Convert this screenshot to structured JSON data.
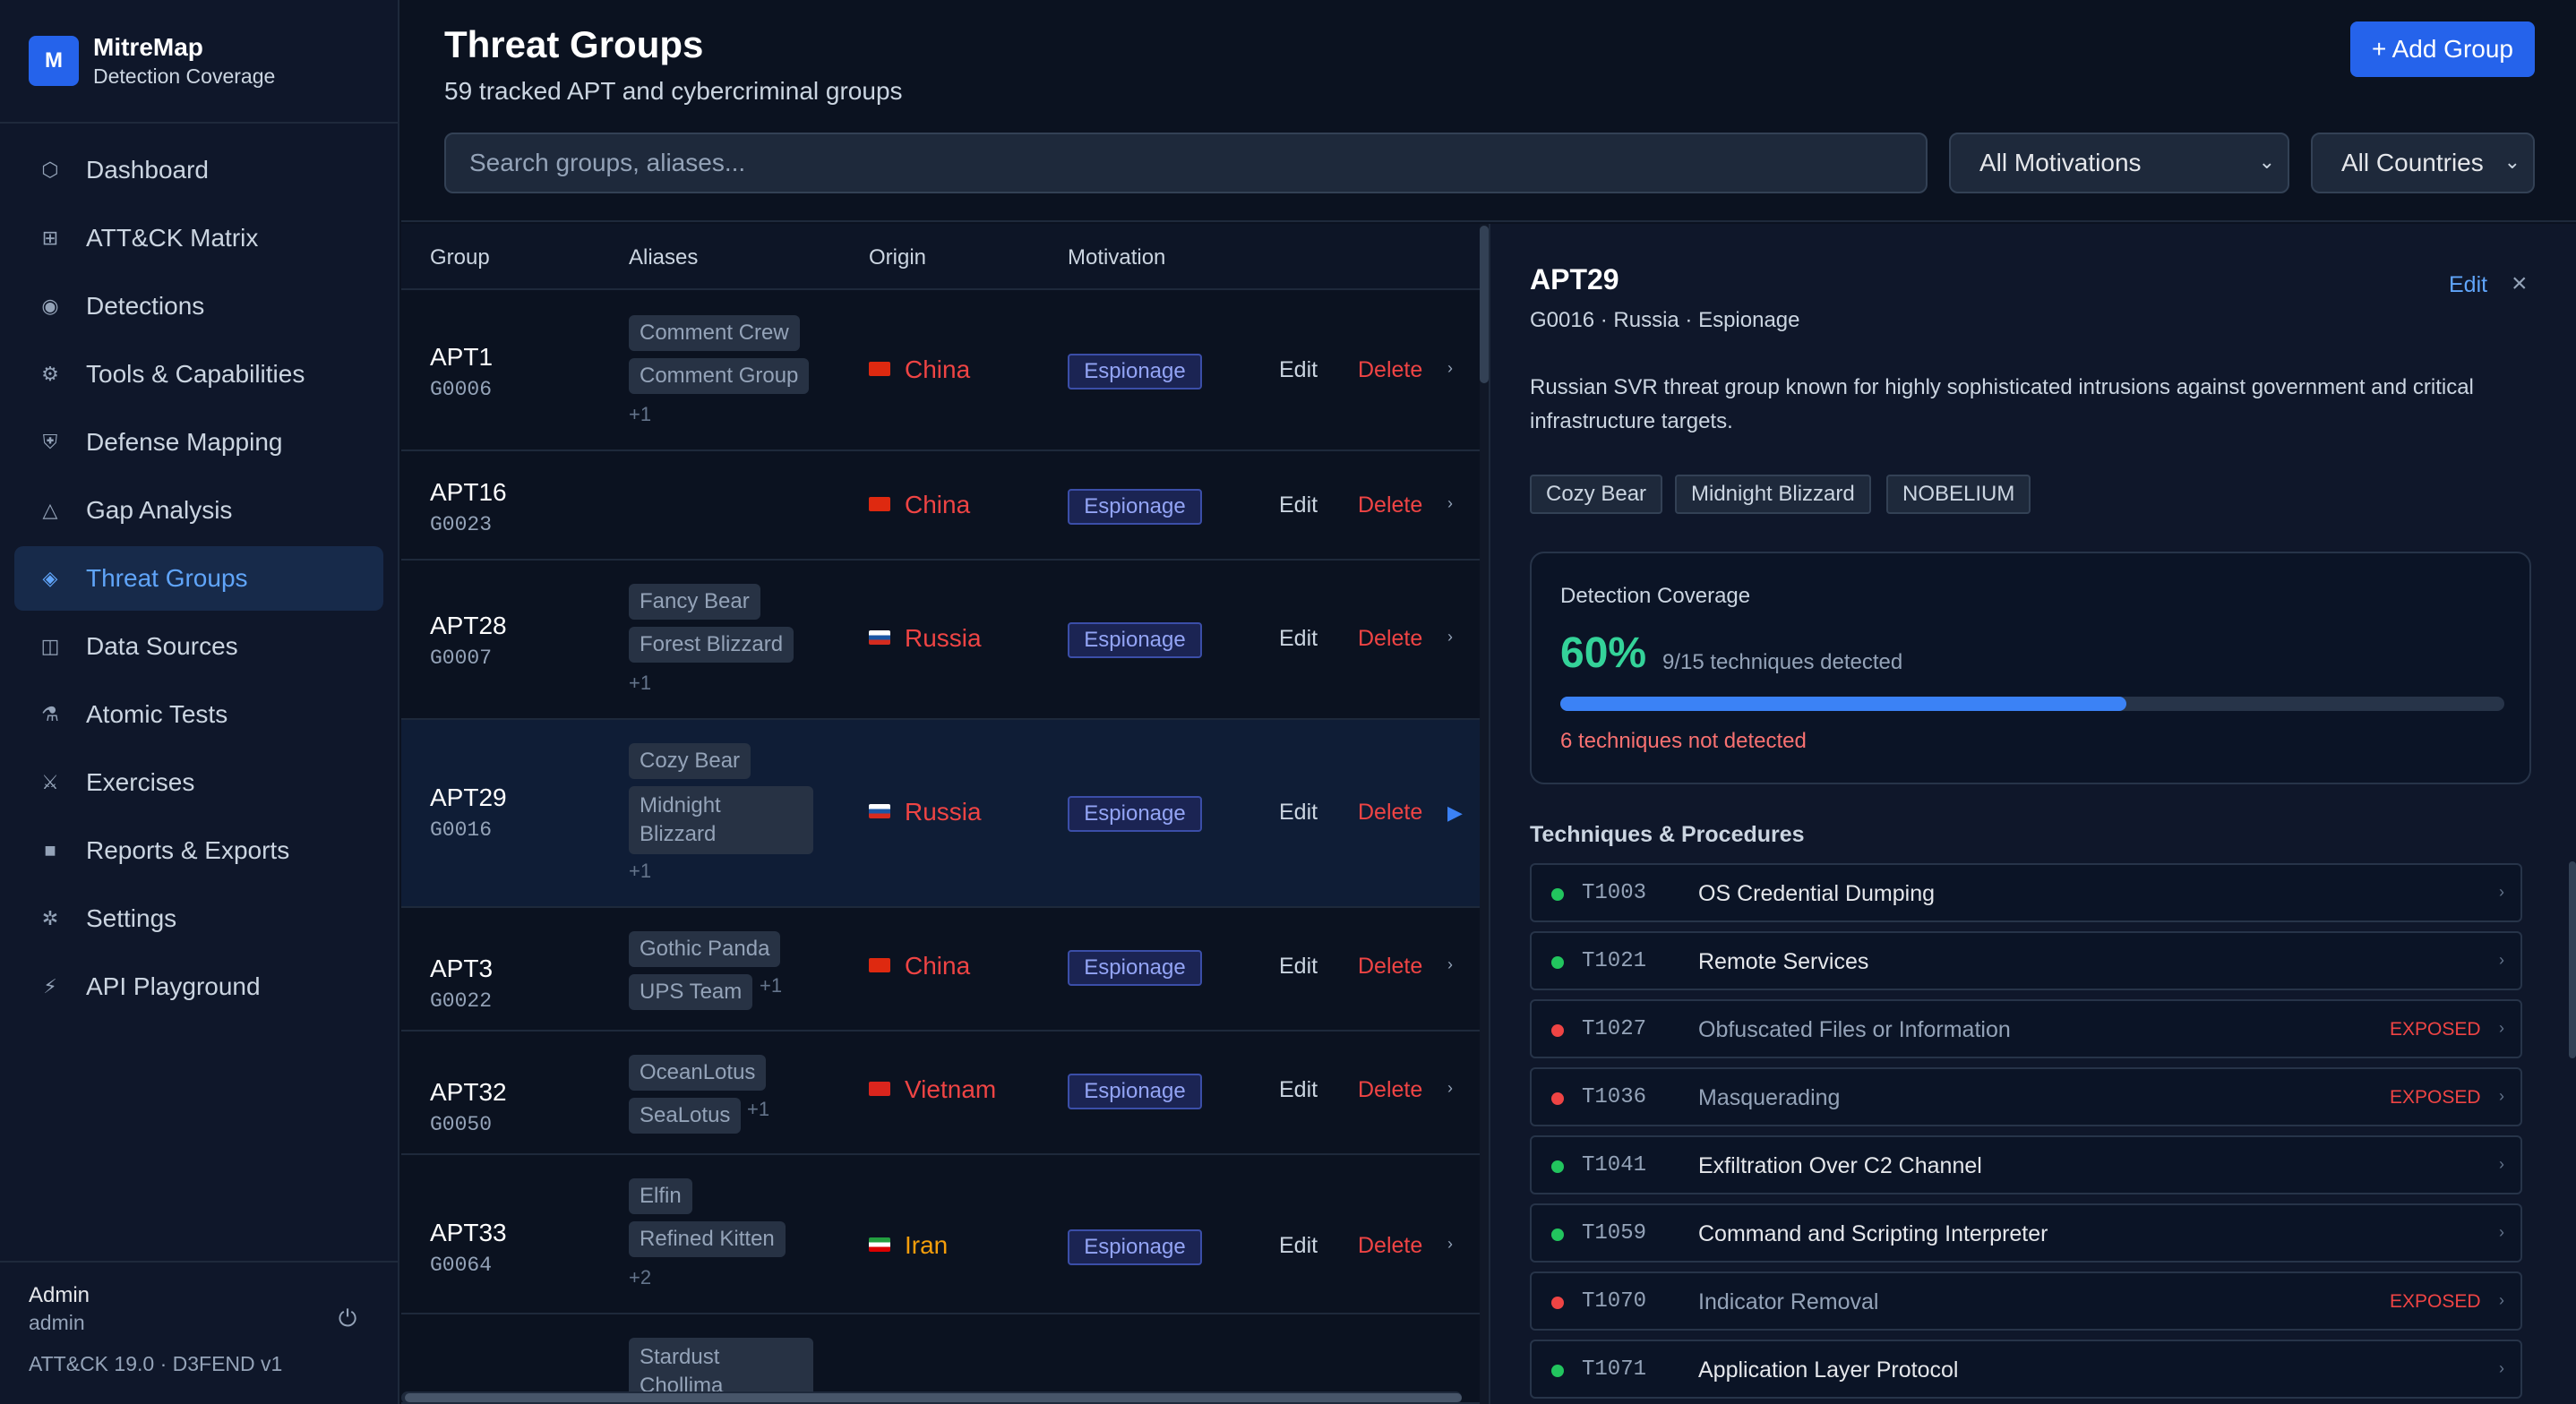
{
  "brand": {
    "logo_letter": "M",
    "name": "MitreMap",
    "subtitle": "Detection Coverage"
  },
  "nav": [
    {
      "label": "Dashboard",
      "icon": "hexagon-icon",
      "glyph": "⬡",
      "active": false
    },
    {
      "label": "ATT&CK Matrix",
      "icon": "grid-icon",
      "glyph": "⊞",
      "active": false
    },
    {
      "label": "Detections",
      "icon": "radar-icon",
      "glyph": "◉",
      "active": false
    },
    {
      "label": "Tools & Capabilities",
      "icon": "gear-icon",
      "glyph": "⚙",
      "active": false
    },
    {
      "label": "Defense Mapping",
      "icon": "shield-icon",
      "glyph": "⛨",
      "active": false
    },
    {
      "label": "Gap Analysis",
      "icon": "triangle-icon",
      "glyph": "△",
      "active": false
    },
    {
      "label": "Threat Groups",
      "icon": "diamond-icon",
      "glyph": "◈",
      "active": true
    },
    {
      "label": "Data Sources",
      "icon": "columns-icon",
      "glyph": "◫",
      "active": false
    },
    {
      "label": "Atomic Tests",
      "icon": "flask-icon",
      "glyph": "⚗",
      "active": false
    },
    {
      "label": "Exercises",
      "icon": "swords-icon",
      "glyph": "⚔",
      "active": false
    },
    {
      "label": "Reports & Exports",
      "icon": "report-icon",
      "glyph": "■",
      "active": false
    },
    {
      "label": "Settings",
      "icon": "cog-icon",
      "glyph": "✲",
      "active": false
    },
    {
      "label": "API Playground",
      "icon": "lightning-icon",
      "glyph": "⚡",
      "active": false
    }
  ],
  "user": {
    "name": "Admin",
    "role": "admin",
    "version": "ATT&CK 19.0 · D3FEND v1"
  },
  "header": {
    "title": "Threat Groups",
    "subtitle": "59 tracked APT and cybercriminal groups",
    "add_button": "+ Add Group",
    "search_placeholder": "Search groups, aliases...",
    "motivation_filter": "All Motivations",
    "country_filter": "All Countries"
  },
  "table": {
    "columns": [
      "Group",
      "Aliases",
      "Origin",
      "Motivation"
    ],
    "edit_label": "Edit",
    "delete_label": "Delete",
    "rows": [
      {
        "name": "APT1",
        "id": "G0006",
        "aliases": [
          "Comment Crew",
          "Comment Group"
        ],
        "more": "+1",
        "origin": "China",
        "flag": "cn",
        "origin_color": "#ef4444",
        "motivation": "Espionage"
      },
      {
        "name": "APT16",
        "id": "G0023",
        "aliases": [],
        "more": "",
        "origin": "China",
        "flag": "cn",
        "origin_color": "#ef4444",
        "motivation": "Espionage"
      },
      {
        "name": "APT28",
        "id": "G0007",
        "aliases": [
          "Fancy Bear",
          "Forest Blizzard"
        ],
        "more": "+1",
        "origin": "Russia",
        "flag": "ru",
        "origin_color": "#ef4444",
        "motivation": "Espionage"
      },
      {
        "name": "APT29",
        "id": "G0016",
        "aliases": [
          "Cozy Bear",
          "Midnight",
          "Blizzard"
        ],
        "more": "+1",
        "origin": "Russia",
        "flag": "ru",
        "origin_color": "#ef4444",
        "motivation": "Espionage",
        "selected": true
      },
      {
        "name": "APT3",
        "id": "G0022",
        "aliases": [
          "Gothic Panda",
          "UPS Team"
        ],
        "more": "+1",
        "origin": "China",
        "flag": "cn",
        "origin_color": "#ef4444",
        "motivation": "Espionage"
      },
      {
        "name": "APT32",
        "id": "G0050",
        "aliases": [
          "OceanLotus",
          "SeaLotus"
        ],
        "more": "+1",
        "origin": "Vietnam",
        "flag": "vn",
        "origin_color": "#ef4444",
        "motivation": "Espionage"
      },
      {
        "name": "APT33",
        "id": "G0064",
        "aliases": [
          "Elfin",
          "Refined Kitten"
        ],
        "more": "+2",
        "origin": "Iran",
        "flag": "ir",
        "origin_color": "#f59e0b",
        "motivation": "Espionage"
      },
      {
        "name": "",
        "id": "",
        "aliases": [
          "Stardust",
          "Chollima"
        ],
        "more": "",
        "origin": "",
        "flag": "",
        "origin_color": "#ef4444",
        "motivation": ""
      }
    ]
  },
  "detail": {
    "title": "APT29",
    "meta": "G0016 · Russia · Espionage",
    "edit_label": "Edit",
    "description": "Russian SVR threat group known for highly sophisticated intrusions against government and critical infrastructure targets.",
    "aliases": [
      "Cozy Bear",
      "Midnight Blizzard",
      "NOBELIUM"
    ],
    "coverage": {
      "label": "Detection Coverage",
      "percent_text": "60%",
      "percent": 0.6,
      "detail": "9/15 techniques detected",
      "missing": "6 techniques not detected"
    },
    "techniques_heading": "Techniques & Procedures",
    "exposed_label": "EXPOSED",
    "techniques": [
      {
        "id": "T1003",
        "name": "OS Credential Dumping",
        "exposed": false
      },
      {
        "id": "T1021",
        "name": "Remote Services",
        "exposed": false
      },
      {
        "id": "T1027",
        "name": "Obfuscated Files or Information",
        "exposed": true
      },
      {
        "id": "T1036",
        "name": "Masquerading",
        "exposed": true
      },
      {
        "id": "T1041",
        "name": "Exfiltration Over C2 Channel",
        "exposed": false
      },
      {
        "id": "T1059",
        "name": "Command and Scripting Interpreter",
        "exposed": false
      },
      {
        "id": "T1070",
        "name": "Indicator Removal",
        "exposed": true
      },
      {
        "id": "T1071",
        "name": "Application Layer Protocol",
        "exposed": false
      }
    ]
  },
  "colors": {
    "accent": "#2563eb",
    "detected": "#22c55e",
    "exposed": "#ef4444",
    "coverage_pct": "#34d399"
  }
}
